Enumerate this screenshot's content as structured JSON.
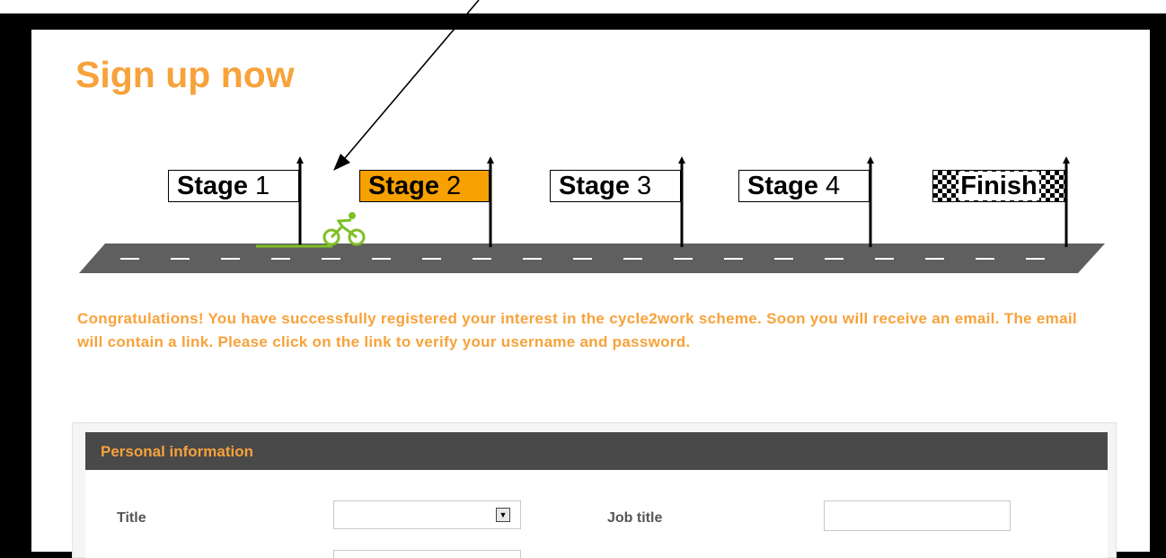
{
  "page": {
    "title": "Sign up now",
    "message": "Congratulations! You have successfully registered your interest in the cycle2work scheme. Soon you will receive an email. The email will contain a link. Please click on the link to verify your username and password."
  },
  "progress": {
    "current_stage": 2,
    "stages": [
      {
        "word": "Stage",
        "num": "1"
      },
      {
        "word": "Stage",
        "num": "2"
      },
      {
        "word": "Stage",
        "num": "3"
      },
      {
        "word": "Stage",
        "num": "4"
      }
    ],
    "finish_label": "Finish"
  },
  "section": {
    "title": "Personal information"
  },
  "form": {
    "title_label": "Title",
    "title_value": "",
    "job_title_label": "Job title",
    "job_title_value": ""
  },
  "colors": {
    "accent": "#f7a23b",
    "active_stage": "#f7a100",
    "header_bg": "#494949",
    "cyclist": "#7fbf26",
    "road": "#5f5f5f"
  },
  "icons": {
    "cyclist": "cyclist-icon",
    "dropdown": "dropdown-arrow-icon"
  }
}
